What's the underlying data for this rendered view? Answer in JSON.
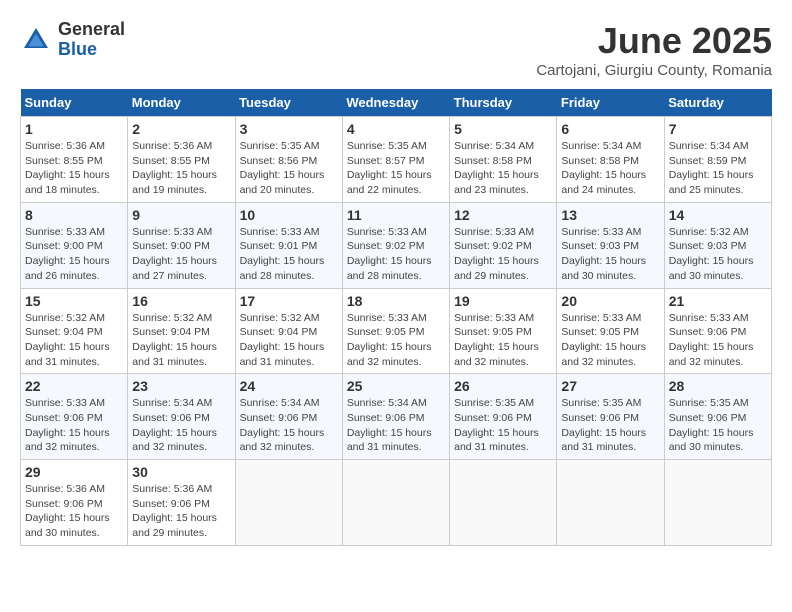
{
  "logo": {
    "general": "General",
    "blue": "Blue"
  },
  "title": {
    "month": "June 2025",
    "location": "Cartojani, Giurgiu County, Romania"
  },
  "weekdays": [
    "Sunday",
    "Monday",
    "Tuesday",
    "Wednesday",
    "Thursday",
    "Friday",
    "Saturday"
  ],
  "weeks": [
    [
      {
        "day": "1",
        "sunrise": "5:36 AM",
        "sunset": "8:55 PM",
        "daylight": "15 hours and 18 minutes."
      },
      {
        "day": "2",
        "sunrise": "5:36 AM",
        "sunset": "8:55 PM",
        "daylight": "15 hours and 19 minutes."
      },
      {
        "day": "3",
        "sunrise": "5:35 AM",
        "sunset": "8:56 PM",
        "daylight": "15 hours and 20 minutes."
      },
      {
        "day": "4",
        "sunrise": "5:35 AM",
        "sunset": "8:57 PM",
        "daylight": "15 hours and 22 minutes."
      },
      {
        "day": "5",
        "sunrise": "5:34 AM",
        "sunset": "8:58 PM",
        "daylight": "15 hours and 23 minutes."
      },
      {
        "day": "6",
        "sunrise": "5:34 AM",
        "sunset": "8:58 PM",
        "daylight": "15 hours and 24 minutes."
      },
      {
        "day": "7",
        "sunrise": "5:34 AM",
        "sunset": "8:59 PM",
        "daylight": "15 hours and 25 minutes."
      }
    ],
    [
      {
        "day": "8",
        "sunrise": "5:33 AM",
        "sunset": "9:00 PM",
        "daylight": "15 hours and 26 minutes."
      },
      {
        "day": "9",
        "sunrise": "5:33 AM",
        "sunset": "9:00 PM",
        "daylight": "15 hours and 27 minutes."
      },
      {
        "day": "10",
        "sunrise": "5:33 AM",
        "sunset": "9:01 PM",
        "daylight": "15 hours and 28 minutes."
      },
      {
        "day": "11",
        "sunrise": "5:33 AM",
        "sunset": "9:02 PM",
        "daylight": "15 hours and 28 minutes."
      },
      {
        "day": "12",
        "sunrise": "5:33 AM",
        "sunset": "9:02 PM",
        "daylight": "15 hours and 29 minutes."
      },
      {
        "day": "13",
        "sunrise": "5:33 AM",
        "sunset": "9:03 PM",
        "daylight": "15 hours and 30 minutes."
      },
      {
        "day": "14",
        "sunrise": "5:32 AM",
        "sunset": "9:03 PM",
        "daylight": "15 hours and 30 minutes."
      }
    ],
    [
      {
        "day": "15",
        "sunrise": "5:32 AM",
        "sunset": "9:04 PM",
        "daylight": "15 hours and 31 minutes."
      },
      {
        "day": "16",
        "sunrise": "5:32 AM",
        "sunset": "9:04 PM",
        "daylight": "15 hours and 31 minutes."
      },
      {
        "day": "17",
        "sunrise": "5:32 AM",
        "sunset": "9:04 PM",
        "daylight": "15 hours and 31 minutes."
      },
      {
        "day": "18",
        "sunrise": "5:33 AM",
        "sunset": "9:05 PM",
        "daylight": "15 hours and 32 minutes."
      },
      {
        "day": "19",
        "sunrise": "5:33 AM",
        "sunset": "9:05 PM",
        "daylight": "15 hours and 32 minutes."
      },
      {
        "day": "20",
        "sunrise": "5:33 AM",
        "sunset": "9:05 PM",
        "daylight": "15 hours and 32 minutes."
      },
      {
        "day": "21",
        "sunrise": "5:33 AM",
        "sunset": "9:06 PM",
        "daylight": "15 hours and 32 minutes."
      }
    ],
    [
      {
        "day": "22",
        "sunrise": "5:33 AM",
        "sunset": "9:06 PM",
        "daylight": "15 hours and 32 minutes."
      },
      {
        "day": "23",
        "sunrise": "5:34 AM",
        "sunset": "9:06 PM",
        "daylight": "15 hours and 32 minutes."
      },
      {
        "day": "24",
        "sunrise": "5:34 AM",
        "sunset": "9:06 PM",
        "daylight": "15 hours and 32 minutes."
      },
      {
        "day": "25",
        "sunrise": "5:34 AM",
        "sunset": "9:06 PM",
        "daylight": "15 hours and 31 minutes."
      },
      {
        "day": "26",
        "sunrise": "5:35 AM",
        "sunset": "9:06 PM",
        "daylight": "15 hours and 31 minutes."
      },
      {
        "day": "27",
        "sunrise": "5:35 AM",
        "sunset": "9:06 PM",
        "daylight": "15 hours and 31 minutes."
      },
      {
        "day": "28",
        "sunrise": "5:35 AM",
        "sunset": "9:06 PM",
        "daylight": "15 hours and 30 minutes."
      }
    ],
    [
      {
        "day": "29",
        "sunrise": "5:36 AM",
        "sunset": "9:06 PM",
        "daylight": "15 hours and 30 minutes."
      },
      {
        "day": "30",
        "sunrise": "5:36 AM",
        "sunset": "9:06 PM",
        "daylight": "15 hours and 29 minutes."
      },
      null,
      null,
      null,
      null,
      null
    ]
  ]
}
